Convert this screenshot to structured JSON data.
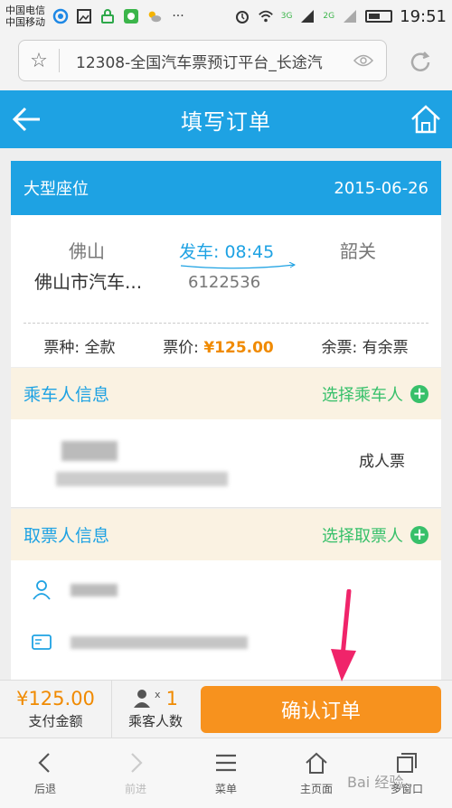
{
  "status_bar": {
    "carrier_1": "中国电信",
    "carrier_2": "中国移动",
    "signal_3g": "3G",
    "signal_2g": "2G",
    "time": "19:51"
  },
  "browser": {
    "url_title": "12308-全国汽车票预订平台_长途汽"
  },
  "header": {
    "title": "填写订单"
  },
  "ticket": {
    "seat_type": "大型座位",
    "date": "2015-06-26",
    "from_city": "佛山",
    "from_station": "佛山市汽车...",
    "depart_label": "发车: 08:45",
    "bus_no": "6122536",
    "to_city": "韶关",
    "ticket_kind_label": "票种: 全款",
    "price_label": "票价: ",
    "price_value": "¥125.00",
    "remaining_label": "余票: 有余票"
  },
  "passenger_section": {
    "title": "乘车人信息",
    "select_label": "选择乘车人",
    "passenger_type": "成人票"
  },
  "collector_section": {
    "title": "取票人信息",
    "select_label": "选择取票人"
  },
  "bottom_bar": {
    "total_amount": "¥125.00",
    "total_label": "支付金额",
    "pax_count": "1",
    "pax_x": "x",
    "pax_label": "乘客人数",
    "confirm_label": "确认订单"
  },
  "toolbar": {
    "items": [
      {
        "label": "后退",
        "icon": "back-icon"
      },
      {
        "label": "前进",
        "icon": "forward-icon"
      },
      {
        "label": "菜单",
        "icon": "menu-icon"
      },
      {
        "label": "主页面",
        "icon": "home-icon"
      },
      {
        "label": "多窗口",
        "icon": "windows-icon"
      }
    ],
    "watermark": "Bai 经验"
  },
  "colors": {
    "primary": "#1ea2e3",
    "accent": "#f7921e",
    "price": "#f08a00",
    "green": "#37c06a",
    "arrow": "#f0246a"
  }
}
